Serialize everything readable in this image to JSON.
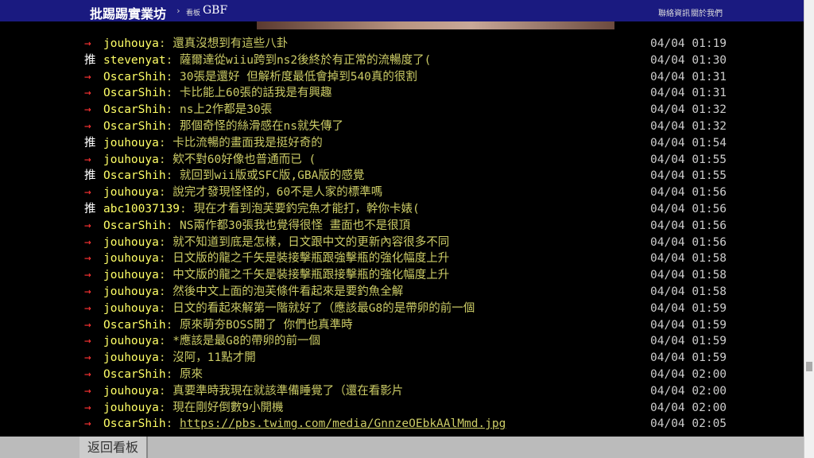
{
  "header": {
    "site_title": "批踢踢實業坊",
    "crumb_arrow": "›",
    "crumb_label": "看板",
    "board": "GBF",
    "nav": [
      "聯絡資訊",
      "關於我們"
    ]
  },
  "comments": [
    {
      "tag": "→",
      "type": "arrow",
      "user": "jouhouya",
      "content": ": 還真沒想到有這些八卦",
      "time": "04/04 01:19"
    },
    {
      "tag": "推",
      "type": "push",
      "user": "stevenyat",
      "content": ": 薩爾達從wiiu跨到ns2後終於有正常的流暢度了(",
      "time": "04/04 01:30"
    },
    {
      "tag": "→",
      "type": "arrow",
      "user": "OscarShih",
      "content": ": 30張是還好 但解析度最低會掉到540真的很割",
      "time": "04/04 01:31"
    },
    {
      "tag": "→",
      "type": "arrow",
      "user": "OscarShih",
      "content": ": 卡比能上60張的話我是有興趣",
      "time": "04/04 01:31"
    },
    {
      "tag": "→",
      "type": "arrow",
      "user": "OscarShih",
      "content": ": ns上2作都是30張",
      "time": "04/04 01:32"
    },
    {
      "tag": "→",
      "type": "arrow",
      "user": "OscarShih",
      "content": ": 那個奇怪的絲滑感在ns就失傳了",
      "time": "04/04 01:32"
    },
    {
      "tag": "推",
      "type": "push",
      "user": "jouhouya",
      "content": ": 卡比流暢的畫面我是挺好奇的",
      "time": "04/04 01:54"
    },
    {
      "tag": "→",
      "type": "arrow",
      "user": "jouhouya",
      "content": ": 欸不對60好像也普通而已 (",
      "time": "04/04 01:55"
    },
    {
      "tag": "推",
      "type": "push",
      "user": "OscarShih",
      "content": ": 就回到wii版或SFC版,GBA版的感覺",
      "time": "04/04 01:55"
    },
    {
      "tag": "→",
      "type": "arrow",
      "user": "jouhouya",
      "content": ": 說完才發現怪怪的，60不是人家的標準嗎",
      "time": "04/04 01:56"
    },
    {
      "tag": "推",
      "type": "push",
      "user": "abc10037139",
      "content": ": 現在才看到泡芙要釣完魚才能打，幹你卡婊(",
      "time": "04/04 01:56"
    },
    {
      "tag": "→",
      "type": "arrow",
      "user": "OscarShih",
      "content": ": NS兩作都30張我也覺得很怪 畫面也不是很頂",
      "time": "04/04 01:56"
    },
    {
      "tag": "→",
      "type": "arrow",
      "user": "jouhouya",
      "content": ": 就不知道到底是怎樣，日文跟中文的更新內容很多不同",
      "time": "04/04 01:56"
    },
    {
      "tag": "→",
      "type": "arrow",
      "user": "jouhouya",
      "content": ": 日文版的龍之千矢是裝接擊瓶跟強擊瓶的強化幅度上升",
      "time": "04/04 01:58"
    },
    {
      "tag": "→",
      "type": "arrow",
      "user": "jouhouya",
      "content": ": 中文版的龍之千矢是裝接擊瓶跟接擊瓶的強化幅度上升",
      "time": "04/04 01:58"
    },
    {
      "tag": "→",
      "type": "arrow",
      "user": "jouhouya",
      "content": ": 然後中文上面的泡芙條件看起來是要釣魚全解",
      "time": "04/04 01:58"
    },
    {
      "tag": "→",
      "type": "arrow",
      "user": "jouhouya",
      "content": ": 日文的看起來解第一階就好了（應該最G8的是帶卵的前一個",
      "time": "04/04 01:59"
    },
    {
      "tag": "→",
      "type": "arrow",
      "user": "OscarShih",
      "content": ": 原來萌夯BOSS開了 你們也真準時",
      "time": "04/04 01:59"
    },
    {
      "tag": "→",
      "type": "arrow",
      "user": "jouhouya",
      "content": ": *應該是最G8的帶卵的前一個",
      "time": "04/04 01:59"
    },
    {
      "tag": "→",
      "type": "arrow",
      "user": "jouhouya",
      "content": ": 沒阿，11點才開",
      "time": "04/04 01:59"
    },
    {
      "tag": "→",
      "type": "arrow",
      "user": "OscarShih",
      "content": ": 原來",
      "time": "04/04 02:00"
    },
    {
      "tag": "→",
      "type": "arrow",
      "user": "jouhouya",
      "content": ": 真要準時我現在就該準備睡覺了（還在看影片",
      "time": "04/04 02:00"
    },
    {
      "tag": "→",
      "type": "arrow",
      "user": "jouhouya",
      "content": ": 現在剛好倒數9小開機",
      "time": "04/04 02:00"
    },
    {
      "tag": "→",
      "type": "arrow",
      "user": "OscarShih",
      "content": ": ",
      "link": "https://pbs.twimg.com/media/GnnzeOEbkAAlMmd.jpg",
      "time": "04/04 02:05"
    }
  ],
  "footer": {
    "back_label": "返回看板"
  },
  "colors": {
    "header_bg": "#1a1a80",
    "push_arrow": "#ff3333",
    "user": "#ffff66",
    "content": "#cccc66",
    "background": "#000000"
  }
}
